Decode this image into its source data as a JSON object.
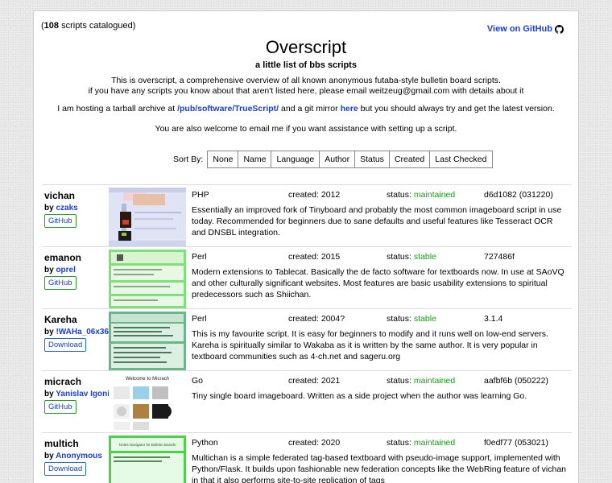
{
  "header": {
    "count_number": "108",
    "count_suffix": " scripts catalogued)",
    "count_prefix": "(",
    "github_label": "View on GitHub",
    "title": "Overscript",
    "subtitle": "a little list of bbs scripts",
    "intro_line1": "This is overscript, a comprehensive overview of all known anonymous futaba-style bulletin board scripts.",
    "intro_line2": "if you have any scripts you know about that aren't listed here, please email weitzeug@gmail.com with details about it",
    "archive_prefix": "I am hosting a tarball archive at ",
    "archive_link": "/pub/software/TrueScript/",
    "archive_middle": " and a git mirror ",
    "archive_here": "here",
    "archive_suffix": " but you should always try and get the latest version.",
    "email_text": "You are also welcome to email me if you want assistance with setting up a script."
  },
  "sort": {
    "label": "Sort By:",
    "options": [
      "None",
      "Name",
      "Language",
      "Author",
      "Status",
      "Created",
      "Last Checked"
    ]
  },
  "entries": [
    {
      "name": "vichan",
      "by": "by ",
      "author": "czaks",
      "button": "GitHub",
      "lang": "PHP",
      "created": "created: 2012",
      "status_label": "status: ",
      "status": "maintained",
      "version": "d6d1082 (031220)",
      "desc": "Essentially an improved fork of Tinyboard and probably the most common imageboard script in use today. Recommended for beginners due to sane defaults and useful features like Tesseract OCR and DNSBL integration."
    },
    {
      "name": "emanon",
      "by": "by ",
      "author": "oprel",
      "button": "GitHub",
      "lang": "Perl",
      "created": "created: 2015",
      "status_label": "status: ",
      "status": "stable",
      "version": "727486f",
      "desc": "Modern extensions to Tablecat. Basically the de facto software for textboards now. In use at SAoVQ and other culturally significant websites. Most features are basic usability extensions to spiritual predecessors such as Shiichan."
    },
    {
      "name": "Kareha",
      "by": "by ",
      "author": "!WAHa_06x36",
      "button": "Download",
      "lang": "Perl",
      "created": "created: 2004?",
      "status_label": "status: ",
      "status": "stable",
      "version": "3.1.4",
      "desc": "This is my favourite script. It is easy for beginners to modify and it runs well on low-end servers. Kareha is spiritually similar to Wakaba as it is written by the same author. It is very popular in textboard communities such as 4-ch.net and sageru.org"
    },
    {
      "name": "micrach",
      "by": "by ",
      "author": "Yanislav Igonin",
      "button": "GitHub",
      "lang": "Go",
      "created": "created: 2021",
      "status_label": "status: ",
      "status": "maintained",
      "version": "aafbf6b (050222)",
      "desc": "Tiny single board imageboard. Written as a side project when the author was learning Go."
    },
    {
      "name": "multich",
      "by": "by ",
      "author": "Anonymous",
      "button": "Download",
      "lang": "Python",
      "created": "created: 2020",
      "status_label": "status: ",
      "status": "maintained",
      "version": "f0edf77 (053021)",
      "desc": "Multichan is a simple federated tag-based textboard with pseudo-image support, implemented with Python/Flask. It builds upon fashionable new federation concepts like the WebRing feature of vichan in that it also performs site-to-site replication of tags"
    }
  ],
  "thumb_text": {
    "micrach": "Welcome to Micrach",
    "multich": "Notes Navigator for Bulletin Boards"
  },
  "colors": {
    "link": "#1a3fd0",
    "status_green": "#1e9a1e",
    "github_border": "#2a9a2a"
  }
}
